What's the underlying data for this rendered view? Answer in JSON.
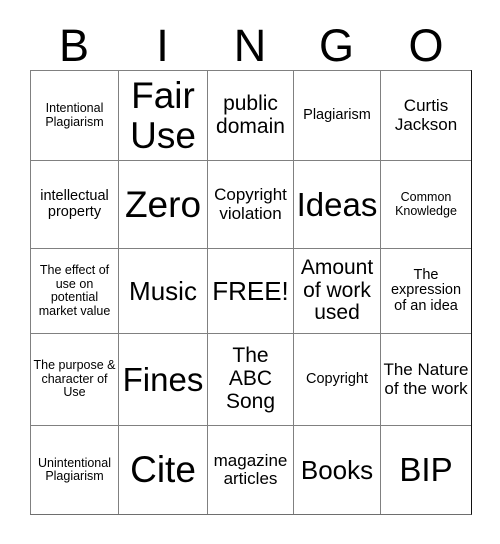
{
  "card": {
    "header_letters": [
      "B",
      "I",
      "N",
      "G",
      "O"
    ],
    "rows": [
      [
        {
          "text": "Intentional Plagiarism",
          "size": "xs"
        },
        {
          "text": "Fair Use",
          "size": "huge"
        },
        {
          "text": "public domain",
          "size": "l"
        },
        {
          "text": "Plagiarism",
          "size": "s"
        },
        {
          "text": "Curtis Jackson",
          "size": "m"
        }
      ],
      [
        {
          "text": "intellectual property",
          "size": "s"
        },
        {
          "text": "Zero",
          "size": "huge"
        },
        {
          "text": "Copyright violation",
          "size": "m"
        },
        {
          "text": "Ideas",
          "size": "xxl"
        },
        {
          "text": "Common Knowledge",
          "size": "xs"
        }
      ],
      [
        {
          "text": "The effect of use on potential market value",
          "size": "xs"
        },
        {
          "text": "Music",
          "size": "xl"
        },
        {
          "text": "FREE!",
          "size": "xl"
        },
        {
          "text": "Amount of work used",
          "size": "l"
        },
        {
          "text": "The expression of an idea",
          "size": "s"
        }
      ],
      [
        {
          "text": "The purpose & character of Use",
          "size": "xs"
        },
        {
          "text": "Fines",
          "size": "xxl"
        },
        {
          "text": "The ABC Song",
          "size": "l"
        },
        {
          "text": "Copyright",
          "size": "s"
        },
        {
          "text": "The Nature of the work",
          "size": "m"
        }
      ],
      [
        {
          "text": "Unintentional Plagiarism",
          "size": "xs"
        },
        {
          "text": "Cite",
          "size": "huge"
        },
        {
          "text": "magazine articles",
          "size": "m"
        },
        {
          "text": "Books",
          "size": "xl"
        },
        {
          "text": "BIP",
          "size": "xxl"
        }
      ]
    ],
    "colors": {
      "background": "#ffffff",
      "text": "#000000",
      "grid_line": "#808080",
      "grid_edge": "#111111"
    }
  }
}
